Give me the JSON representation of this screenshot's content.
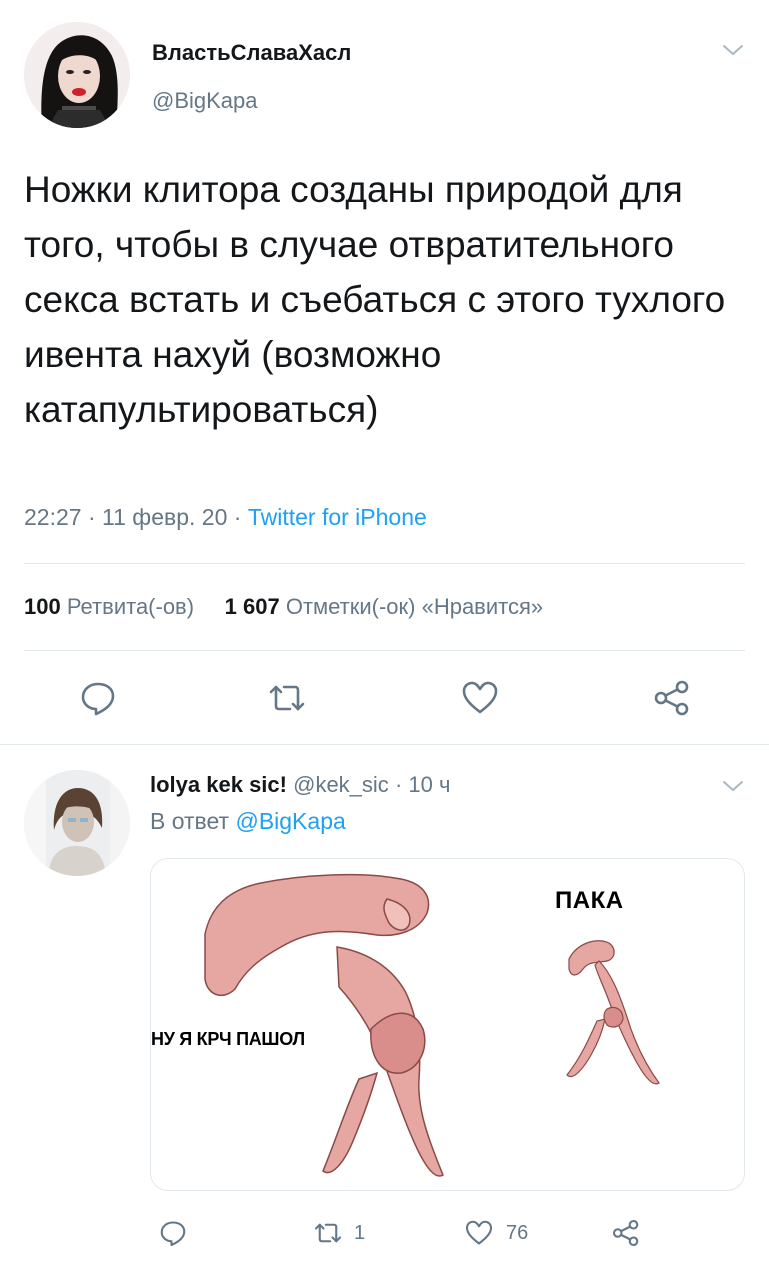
{
  "tweet": {
    "author_name": "ВластьСлаваХасл",
    "author_handle": "@BigKapa",
    "text": "Ножки клитора созданы природой для того, чтобы в случае отвратительного секса встать и съебаться с этого тухлого ивента нахуй (возможно катапультироваться)",
    "time": "22:27",
    "date": "11 февр. 20",
    "source": "Twitter for iPhone",
    "retweets_count": "100",
    "retweets_label": "Ретвита(-ов)",
    "likes_count": "1 607",
    "likes_label": "Отметки(-ок) «Нравится»"
  },
  "reply": {
    "author_name": "lolya kek sic!",
    "author_handle": "@kek_sic",
    "age": "10 ч",
    "reply_to_prefix": "В ответ",
    "reply_to_handle": "@BigKapa",
    "media": {
      "label_left": "НУ Я КРЧ ПАШОЛ",
      "label_right": "ПАКА"
    },
    "retweet_count": "1",
    "like_count": "76"
  },
  "colors": {
    "link": "#1da1f2",
    "secondary_text": "#657786",
    "primary_text": "#14171a",
    "divider": "#e1e8ed",
    "icon": "#657786"
  },
  "icons": [
    "chevron-down-icon",
    "reply-icon",
    "retweet-icon",
    "like-icon",
    "share-icon"
  ]
}
